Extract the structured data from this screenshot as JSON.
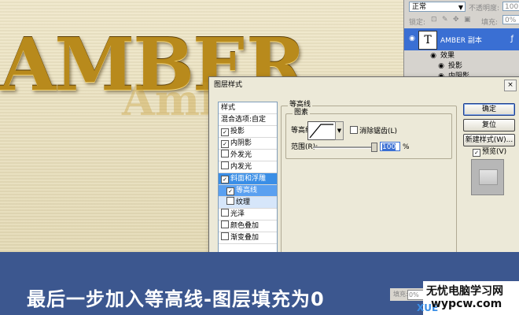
{
  "canvas": {
    "headline": "AMBER",
    "echo_text": "AmbeR"
  },
  "layers_panel": {
    "blend_mode": "正常",
    "opacity_label": "不透明度:",
    "opacity_value": "100",
    "lock_label": "锁定:",
    "fill_label": "填充:",
    "fill_value": "0%",
    "layer_name": "AMBER 副本",
    "layer_thumb": "T",
    "effects_label": "效果",
    "effect_items": [
      "投影",
      "内阴影"
    ]
  },
  "dialog": {
    "title": "图层样式",
    "close_glyph": "×",
    "styles_header": "样式",
    "blend_options": "混合选项:自定",
    "style_items": [
      {
        "label": "投影",
        "checked": "✓"
      },
      {
        "label": "内阴影",
        "checked": "✓"
      },
      {
        "label": "外发光",
        "checked": ""
      },
      {
        "label": "内发光",
        "checked": ""
      },
      {
        "label": "斜面和浮雕",
        "checked": "✓"
      },
      {
        "label": "等高线",
        "checked": "✓"
      },
      {
        "label": "纹理",
        "checked": ""
      },
      {
        "label": "光泽",
        "checked": ""
      },
      {
        "label": "颜色叠加",
        "checked": ""
      },
      {
        "label": "渐变叠加",
        "checked": ""
      }
    ],
    "section_title": "等高线",
    "group_title": "图素",
    "contour_label": "等高线:",
    "antialias_label": "消除锯齿(L)",
    "range_label": "范围(R):",
    "range_value": "100",
    "range_unit": "%",
    "buttons": {
      "ok": "确定",
      "reset": "复位",
      "new_style": "新建样式(W)...",
      "preview": "预览(V)"
    },
    "preview_checked": "✓"
  },
  "banner": {
    "caption": "最后一步加入等高线-图层填充为0",
    "fill_label": "填充:",
    "fill_value": "0%",
    "watermark_line1": "无忧电脑学习网",
    "watermark_line2": "wypcw.com",
    "watermark_blue": "XUE"
  },
  "colors": {
    "banner": "#3c578f",
    "selection": "#3a8ee6",
    "gold": "#b88a1c"
  }
}
